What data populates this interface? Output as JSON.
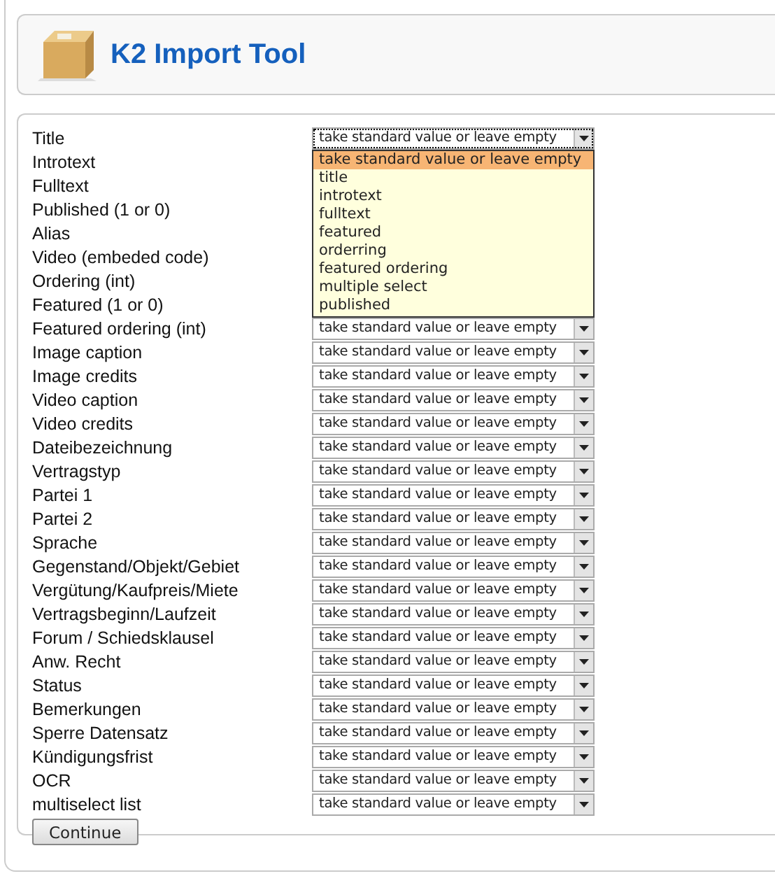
{
  "header": {
    "title": "K2 Import Tool"
  },
  "fields": [
    {
      "label": "Title",
      "value": "take standard value or leave empty",
      "focused": true
    },
    {
      "label": "Introtext"
    },
    {
      "label": "Fulltext"
    },
    {
      "label": "Published (1 or 0)"
    },
    {
      "label": "Alias"
    },
    {
      "label": "Video (embeded code)"
    },
    {
      "label": "Ordering (int)"
    },
    {
      "label": "Featured (1 or 0)"
    },
    {
      "label": "Featured ordering (int)",
      "value": "take standard value or leave empty",
      "focused": false
    },
    {
      "label": "Image caption",
      "value": "take standard value or leave empty",
      "focused": false
    },
    {
      "label": "Image credits",
      "value": "take standard value or leave empty",
      "focused": false
    },
    {
      "label": "Video caption",
      "value": "take standard value or leave empty",
      "focused": false
    },
    {
      "label": "Video credits",
      "value": "take standard value or leave empty",
      "focused": false
    },
    {
      "label": "Dateibezeichnung",
      "value": "take standard value or leave empty",
      "focused": false
    },
    {
      "label": "Vertragstyp",
      "value": "take standard value or leave empty",
      "focused": false
    },
    {
      "label": "Partei 1",
      "value": "take standard value or leave empty",
      "focused": false
    },
    {
      "label": "Partei 2",
      "value": "take standard value or leave empty",
      "focused": false
    },
    {
      "label": "Sprache",
      "value": "take standard value or leave empty",
      "focused": false
    },
    {
      "label": "Gegenstand/Objekt/Gebiet",
      "value": "take standard value or leave empty",
      "focused": false
    },
    {
      "label": "Vergütung/Kaufpreis/Miete",
      "value": "take standard value or leave empty",
      "focused": false
    },
    {
      "label": "Vertragsbeginn/Laufzeit",
      "value": "take standard value or leave empty",
      "focused": false
    },
    {
      "label": "Forum / Schiedsklausel",
      "value": "take standard value or leave empty",
      "focused": false
    },
    {
      "label": "Anw. Recht",
      "value": "take standard value or leave empty",
      "focused": false
    },
    {
      "label": "Status",
      "value": "take standard value or leave empty",
      "focused": false
    },
    {
      "label": "Bemerkungen",
      "value": "take standard value or leave empty",
      "focused": false
    },
    {
      "label": "Sperre Datensatz",
      "value": "take standard value or leave empty",
      "focused": false
    },
    {
      "label": "Kündigungsfrist",
      "value": "take standard value or leave empty",
      "focused": false
    },
    {
      "label": "OCR",
      "value": "take standard value or leave empty",
      "focused": false
    },
    {
      "label": "multiselect list",
      "value": "take standard value or leave empty",
      "focused": false
    }
  ],
  "dropdown": {
    "options": [
      {
        "label": "take standard value or leave empty",
        "selected": true
      },
      {
        "label": "title",
        "selected": false
      },
      {
        "label": "introtext",
        "selected": false
      },
      {
        "label": "fulltext",
        "selected": false
      },
      {
        "label": "featured",
        "selected": false
      },
      {
        "label": "orderring",
        "selected": false
      },
      {
        "label": "featured ordering",
        "selected": false
      },
      {
        "label": "multiple select",
        "selected": false
      },
      {
        "label": "published",
        "selected": false
      }
    ]
  },
  "continue_button": "Continue"
}
